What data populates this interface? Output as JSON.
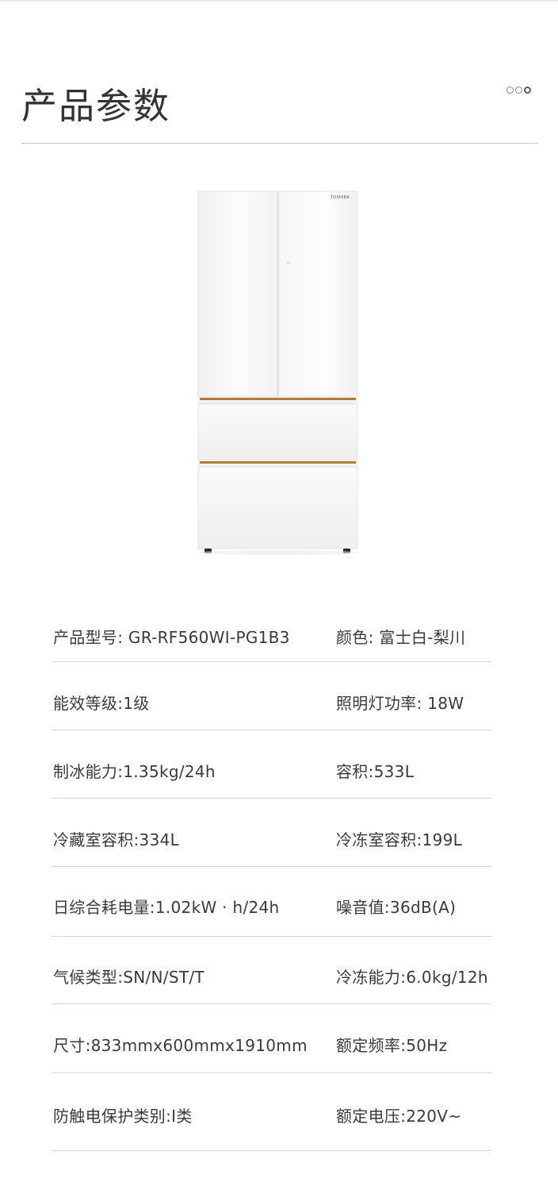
{
  "header": {
    "title": "产品参数"
  },
  "pager": {
    "dots": [
      "",
      "",
      ""
    ],
    "active_index": 2
  },
  "product": {
    "brand_label": "TOSHIBA",
    "colors": {
      "body": "#f7f7f7",
      "trim": "#b07a3a"
    }
  },
  "specs": [
    {
      "left": "产品型号: GR-RF560WI-PG1B3",
      "right": "颜色: 富士白-梨川"
    },
    {
      "left": "能效等级:1级",
      "right": "照明灯功率: 18W"
    },
    {
      "left": "制冰能力:1.35kg/24h",
      "right": "容积:533L"
    },
    {
      "left": "冷藏室容积:334L",
      "right": "冷冻室容积:199L"
    },
    {
      "left": "日综合耗电量:1.02kW · h/24h",
      "right": "噪音值:36dB(A)"
    },
    {
      "left": "气候类型:SN/N/ST/T",
      "right": "冷冻能力:6.0kg/12h"
    },
    {
      "left": "尺寸:833mmx600mmx1910mm",
      "right": "额定频率:50Hz"
    },
    {
      "left": "防触电保护类别:I类",
      "right": "额定电压:220V~"
    }
  ]
}
